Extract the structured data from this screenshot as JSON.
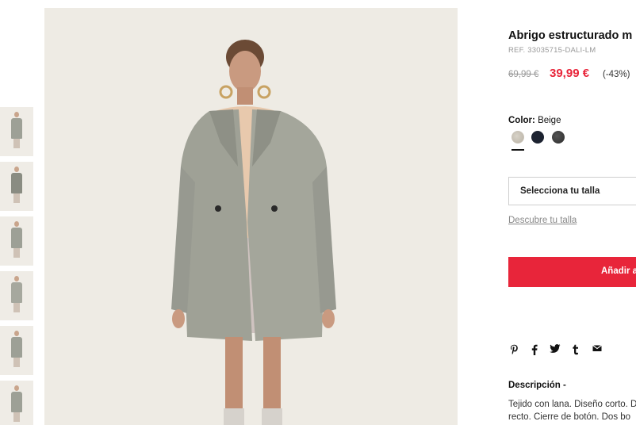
{
  "product": {
    "title": "Abrigo estructurado m",
    "ref": "REF. 33035715-DALI-LM",
    "old_price": "69,99 €",
    "new_price": "39,99 €",
    "discount": "(-43%)"
  },
  "color": {
    "label": "Color:",
    "value": "Beige",
    "swatches": [
      "beige",
      "navy",
      "charcoal"
    ]
  },
  "size": {
    "select_label": "Selecciona tu talla",
    "guide_link": "Descubre tu talla"
  },
  "cart": {
    "add_label": "Añadir a"
  },
  "share": {
    "icons": [
      "pinterest-icon",
      "facebook-icon",
      "twitter-icon",
      "tumblr-icon",
      "email-icon"
    ]
  },
  "description": {
    "heading": "Descripción -",
    "line1": "Tejido con lana. Diseño corto. D",
    "line2": "recto. Cierre de botón. Dos bo"
  },
  "colors": {
    "accent": "#e8253a",
    "coat": "#9fa196",
    "background": "#eeebe4"
  }
}
